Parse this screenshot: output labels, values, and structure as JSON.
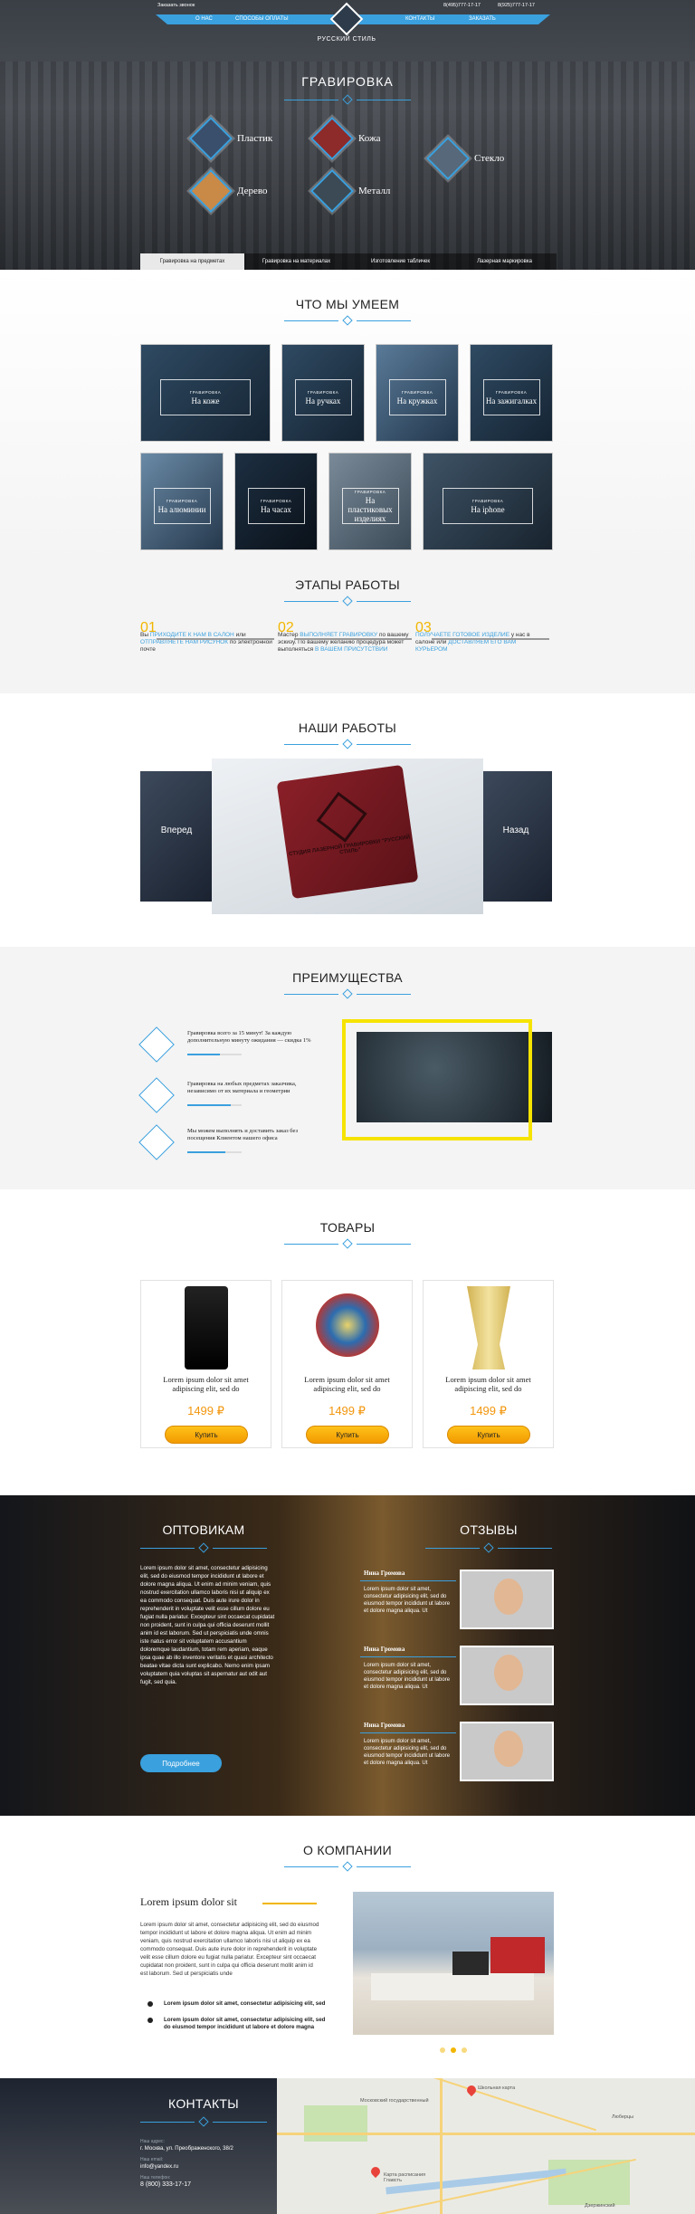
{
  "header": {
    "callback": "Заказать звонок",
    "phone1": "8(495)777-17-17",
    "phone2": "8(925)777-17-17",
    "nav": [
      "О НАС",
      "СПОСОБЫ ОПЛАТЫ",
      "КОНТАКТЫ",
      "ЗАКАЗАТЬ"
    ],
    "logo_name": "РУССКИЙ СТИЛЬ",
    "title": "ГРАВИРОВКА",
    "materials": [
      "Пластик",
      "Кожа",
      "Стекло",
      "Дерево",
      "Металл"
    ],
    "tabs": [
      "Гравировка на предметах",
      "Гравировка на материалах",
      "Изготовление табличек",
      "Лазерная маркировка"
    ]
  },
  "what": {
    "title": "ЧТО МЫ УМЕЕМ",
    "card_small": "ГРАВИРОВКА",
    "cards": [
      "На коже",
      "На ручках",
      "На кружках",
      "На зажигалках",
      "На алюминии",
      "На часах",
      "На пластиковых изделиях",
      "На iphone"
    ]
  },
  "stages": {
    "title": "ЭТАПЫ РАБОТЫ",
    "items": [
      {
        "num": "01",
        "t1": "Вы ",
        "h1": "ПРИХОДИТЕ К НАМ В САЛОН",
        "t2": " или ",
        "h2": "ОТПРАВЛЯЕТЕ НАМ РИСУНОК",
        "t3": " по электронной почте"
      },
      {
        "num": "02",
        "t1": "Мастер ",
        "h1": "ВЫПОЛНЯЕТ ГРАВИРОВКУ",
        "t2": " по вашему эскизу. По вашему желанию процедура может выполняться ",
        "h2": "В ВАШЕМ ПРИСУТСТВИИ",
        "t3": ""
      },
      {
        "num": "03",
        "t1": "",
        "h1": "ПОЛУЧАЕТЕ ГОТОВОЕ ИЗДЕЛИЕ",
        "t2": " у нас в салоне или ",
        "h2": "ДОСТАВЛЯЕМ ЕГО ВАМ КУРЬЕРОМ",
        "t3": ""
      }
    ]
  },
  "works": {
    "title": "НАШИ РАБОТЫ",
    "prev": "Вперед",
    "next": "Назад",
    "wallet_text": "СТУДИЯ ЛАЗЕРНОЙ ГРАВИРОВКИ \"РУССКИЙ СТИЛЬ\""
  },
  "advantages": {
    "title": "ПРЕИМУЩЕСТВА",
    "items": [
      {
        "text": "Гравировка всего за 15 минут! За каждую дополнительную минуту ожидания — скидка 1%",
        "progress": 0.6
      },
      {
        "text": "Гравировка на любых предметах заказчика, независимо от их материала и геометрии",
        "progress": 0.8
      },
      {
        "text": "Мы можем выполнять и доставить заказ без посещения Клиентом нашего офиса",
        "progress": 0.7
      }
    ]
  },
  "goods": {
    "title": "ТОВАРЫ",
    "items": [
      {
        "name": "Lorem ipsum dolor sit amet adipiscing elit, sed do",
        "price": "1499 ₽",
        "btn": "Купить"
      },
      {
        "name": "Lorem ipsum dolor sit amet adipiscing elit, sed do",
        "price": "1499 ₽",
        "btn": "Купить"
      },
      {
        "name": "Lorem ipsum dolor sit amet adipiscing elit, sed do",
        "price": "1499 ₽",
        "btn": "Купить"
      }
    ]
  },
  "wholesale": {
    "title": "ОПТОВИКАМ",
    "text": "Lorem ipsum dolor sit amet, consectetur adipisicing elit, sed do eiusmod tempor incididunt ut labore et dolore magna aliqua. Ut enim ad minim veniam, quis nostrud exercitation ullamco laboris nisi ut aliquip ex ea commodo consequat. Duis aute irure dolor in reprehenderit in voluptate velit esse cillum dolore eu fugiat nulla pariatur. Excepteur sint occaecat cupidatat non proident, sunt in culpa qui officia deserunt mollit anim id est laborum. Sed ut perspiciatis unde omnis iste natus error sit voluptatem accusantium doloremque laudantium, totam rem aperiam, eaque ipsa quae ab illo inventore veritatis et quasi architecto beatae vitae dicta sunt explicabo. Nemo enim ipsam voluptatem quia voluptas sit aspernatur aut odit aut fugit, sed quia.",
    "btn": "Подробнее"
  },
  "reviews": {
    "title": "ОТЗЫВЫ",
    "items": [
      {
        "name": "Нина Громова",
        "text": "Lorem ipsum dolor sit amet, consectetur adipisicing elit, sed do eiusmod tempor incididunt ut labore et dolore magna aliqua. Ut"
      },
      {
        "name": "Нина Громова",
        "text": "Lorem ipsum dolor sit amet, consectetur adipisicing elit, sed do eiusmod tempor incididunt ut labore et dolore magna aliqua. Ut"
      },
      {
        "name": "Нина Громова",
        "text": "Lorem ipsum dolor sit amet, consectetur adipisicing elit, sed do eiusmod tempor incididunt ut labore et dolore magna aliqua. Ut"
      }
    ]
  },
  "about": {
    "title": "О КОМПАНИИ",
    "subtitle": "Lorem ipsum dolor sit",
    "text": "Lorem ipsum dolor sit amet, consectetur adipisicing elit, sed do eiusmod tempor incididunt ut labore et dolore magna aliqua. Ut enim ad minim veniam, quis nostrud exercitation ullamco laboris nisi ut aliquip ex ea commodo consequat. Duis aute irure dolor in reprehenderit in voluptate velit esse cillum dolore eu fugiat nulla pariatur. Excepteur sint occaecat cupidatat non proident, sunt in culpa qui officia deserunt mollit anim id est laborum. Sed ut perspiciatis unde",
    "bullets": [
      "Lorem ipsum dolor sit amet, consectetur adipisicing elit, sed",
      "Lorem ipsum dolor sit amet, consectetur adipisicing elit, sed do eiusmod tempor incididunt ut labore et dolore magna"
    ]
  },
  "contacts": {
    "title": "КОНТАКТЫ",
    "addr_label": "Наш адрес:",
    "addr": "г. Москва, ул. Преображенского, 38/2",
    "email_label": "Наш email:",
    "email": "info@yandex.ru",
    "phone_label": "Наш телефон:",
    "phone": "8 (800) 333-17-17",
    "map_labels": [
      "Школьная карта",
      "Карта расписания Главсть",
      "Люберцы",
      "Московский государственный",
      "Дзержинский"
    ]
  }
}
